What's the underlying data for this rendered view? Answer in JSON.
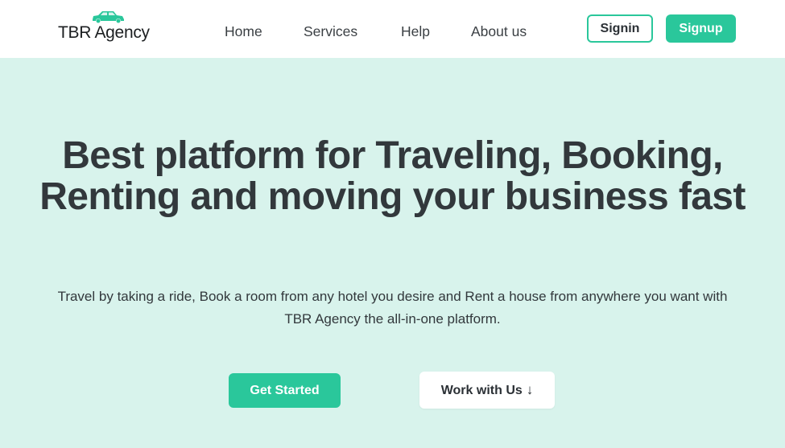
{
  "brand": {
    "name": "TBR Agency",
    "icon": "car-icon",
    "accent_color": "#2ac79b"
  },
  "nav": {
    "links": [
      {
        "label": "Home"
      },
      {
        "label": "Services"
      },
      {
        "label": "Help"
      },
      {
        "label": "About us"
      }
    ],
    "signin_label": "Signin",
    "signup_label": "Signup"
  },
  "hero": {
    "title": "Best platform for Traveling, Booking, Renting and moving your business fast",
    "subtitle": "Travel by taking a ride, Book a room from any hotel you desire and Rent a house from anywhere you want with TBR Agency the all-in-one platform.",
    "primary_cta": "Get Started",
    "secondary_cta": "Work with Us",
    "secondary_cta_icon": "arrow-down-icon",
    "background_color": "#d8f3ec"
  }
}
